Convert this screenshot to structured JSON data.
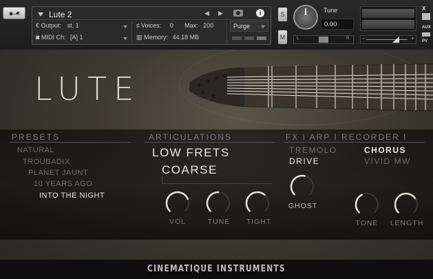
{
  "header": {
    "instrument_name": "Lute 2",
    "output_label": "Output:",
    "output_value": "st. 1",
    "midi_label": "MIDI Ch:",
    "midi_value": "[A]  1",
    "voices_label": "Voices:",
    "voices_value": "0",
    "max_label": "Max:",
    "max_value": "200",
    "memory_label": "Memory:",
    "memory_value": "44.18 MB",
    "purge_label": "Purge",
    "solo_label": "S",
    "mute_label": "M",
    "tune_label": "Tune",
    "tune_value": "0.00",
    "pan_left": "L",
    "pan_right": "R",
    "vol_minus": "−",
    "vol_plus": "+",
    "side_x": "X",
    "side_aux": "AUX",
    "side_pv": "PV"
  },
  "instrument": {
    "logo": "LUTE",
    "presets": {
      "title": "PRESETS",
      "items": [
        "NATURAL",
        "TROUBADIX",
        "PLANET JAUNT",
        "10 YEARS AGO",
        "INTO THE NIGHT"
      ],
      "selected_index": 4
    },
    "articulations": {
      "title": "ARTICULATIONS",
      "items": [
        "LOW FRETS",
        "COARSE"
      ],
      "knobs": [
        {
          "label": "VOL",
          "value": 0.75
        },
        {
          "label": "TUNE",
          "value": 0.5
        },
        {
          "label": "TIGHT",
          "value": 0.65
        }
      ]
    },
    "fx": {
      "title": "FX I ARP I RECORDER I",
      "items": [
        "TREMOLO",
        "CHORUS",
        "DRIVE",
        "VIVID MW"
      ],
      "active": [
        "CHORUS",
        "DRIVE"
      ],
      "knobs": [
        {
          "label": "GHOST",
          "value": 0.55
        },
        {
          "label": "TONE",
          "value": 0.4
        },
        {
          "label": "LENGTH",
          "value": 0.7
        }
      ]
    },
    "footer": "CINEMATIQUE INSTRUMENTS"
  }
}
